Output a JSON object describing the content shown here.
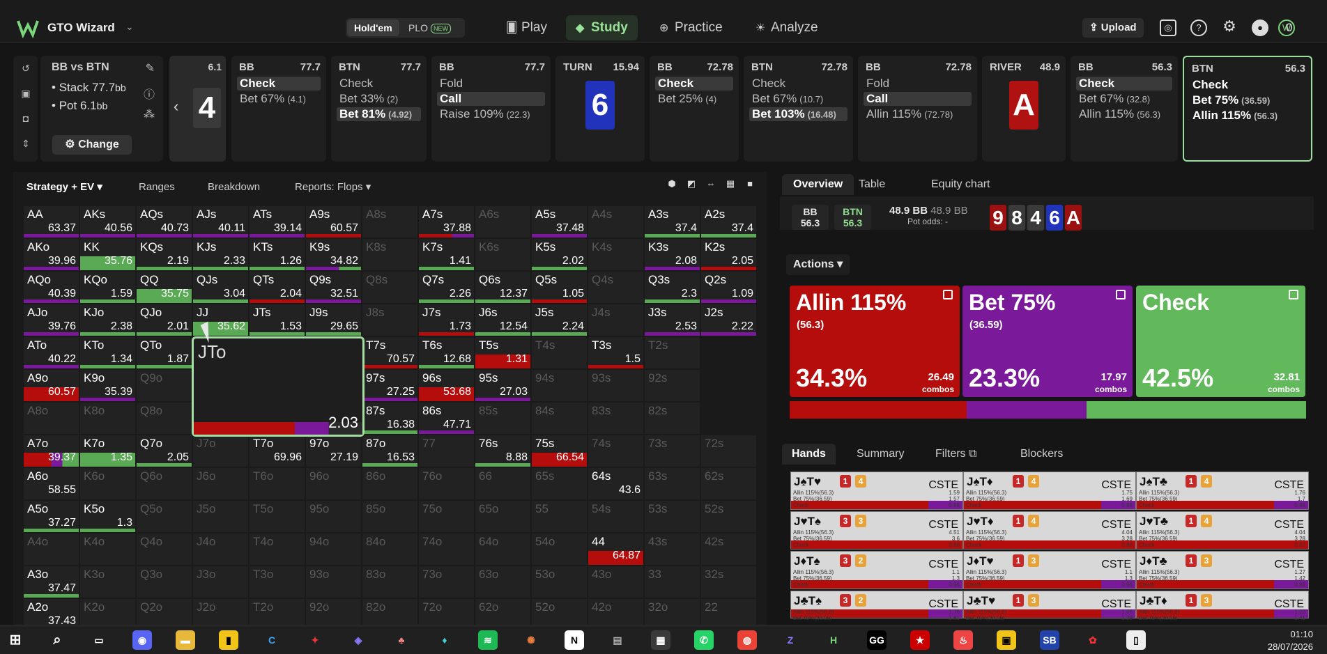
{
  "app": {
    "name": "GTO Wizard",
    "modes": [
      "Hold'em",
      "PLO"
    ],
    "new_badge": "NEW",
    "nav": [
      "Play",
      "Study",
      "Practice",
      "Analyze"
    ],
    "upload": "Upload",
    "credit": "0"
  },
  "spot": {
    "title": "BB vs BTN",
    "stack_label": "Stack",
    "stack": "77.7",
    "pot_label": "Pot",
    "pot": "6.1",
    "bb_unit": "bb",
    "change": "Change",
    "flop_pot": "6.1",
    "flop_card": "4"
  },
  "nodes": [
    {
      "hd": "BB",
      "pot": "77.7",
      "acts": [
        {
          "l": "Check",
          "s": "",
          "sel": true
        },
        {
          "l": "Bet 67%",
          "s": "(4.1)"
        }
      ]
    },
    {
      "hd": "BTN",
      "pot": "77.7",
      "acts": [
        {
          "l": "Check",
          "s": ""
        },
        {
          "l": "Bet 33%",
          "s": "(2)"
        },
        {
          "l": "Bet 81%",
          "s": "(4.92)",
          "sel": true
        }
      ]
    },
    {
      "hd": "BB",
      "pot": "77.7",
      "acts": [
        {
          "l": "Fold",
          "s": ""
        },
        {
          "l": "Call",
          "s": "",
          "sel": true
        },
        {
          "l": "Raise 109%",
          "s": "(22.3)"
        }
      ]
    },
    {
      "hd": "TURN",
      "pot": "15.94",
      "card": "6"
    },
    {
      "hd": "BB",
      "pot": "72.78",
      "acts": [
        {
          "l": "Check",
          "s": "",
          "sel": true
        },
        {
          "l": "Bet 25%",
          "s": "(4)"
        }
      ]
    },
    {
      "hd": "BTN",
      "pot": "72.78",
      "acts": [
        {
          "l": "Check",
          "s": ""
        },
        {
          "l": "Bet 67%",
          "s": "(10.7)"
        },
        {
          "l": "Bet 103%",
          "s": "(16.48)",
          "sel": true
        }
      ]
    },
    {
      "hd": "BB",
      "pot": "72.78",
      "acts": [
        {
          "l": "Fold",
          "s": ""
        },
        {
          "l": "Call",
          "s": "",
          "sel": true
        },
        {
          "l": "Allin 115%",
          "s": "(72.78)"
        }
      ]
    },
    {
      "hd": "RIVER",
      "pot": "48.9",
      "card": "A"
    },
    {
      "hd": "BB",
      "pot": "56.3",
      "acts": [
        {
          "l": "Check",
          "s": "",
          "sel": true
        },
        {
          "l": "Bet 67%",
          "s": "(32.8)"
        },
        {
          "l": "Allin 115%",
          "s": "(56.3)"
        }
      ]
    },
    {
      "hd": "BTN",
      "pot": "56.3",
      "acts": [
        {
          "l": "Check",
          "s": ""
        },
        {
          "l": "Bet 75%",
          "s": "(36.59)"
        },
        {
          "l": "Allin 115%",
          "s": "(56.3)"
        }
      ],
      "cur": true
    }
  ],
  "left_tabs": [
    "Strategy + EV",
    "Ranges",
    "Breakdown",
    "Reports: Flops"
  ],
  "grid": [
    [
      [
        "AA",
        "63.37",
        "p"
      ],
      [
        "AKs",
        "40.56",
        "p"
      ],
      [
        "AQs",
        "40.73",
        "p"
      ],
      [
        "AJs",
        "40.11",
        "p"
      ],
      [
        "ATs",
        "39.14",
        "p"
      ],
      [
        "A9s",
        "60.57",
        "r"
      ],
      [
        "A8s",
        "",
        ""
      ],
      [
        "A7s",
        "37.88",
        "rp"
      ],
      [
        "A6s",
        "",
        ""
      ],
      [
        "A5s",
        "37.48",
        "p"
      ],
      [
        "A4s",
        "",
        ""
      ],
      [
        "A3s",
        "37.4",
        "g"
      ],
      [
        "A2s",
        "37.4",
        "g"
      ]
    ],
    [
      [
        "AKo",
        "39.96",
        "p"
      ],
      [
        "KK",
        "35.76",
        "G"
      ],
      [
        "KQs",
        "2.19",
        "g"
      ],
      [
        "KJs",
        "2.33",
        "g"
      ],
      [
        "KTs",
        "1.26",
        "g"
      ],
      [
        "K9s",
        "34.82",
        "pg"
      ],
      [
        "K8s",
        "",
        ""
      ],
      [
        "K7s",
        "1.41",
        "g"
      ],
      [
        "K6s",
        "",
        ""
      ],
      [
        "K5s",
        "2.02",
        "g"
      ],
      [
        "K4s",
        "",
        ""
      ],
      [
        "K3s",
        "2.08",
        "p"
      ],
      [
        "K2s",
        "2.05",
        "r"
      ]
    ],
    [
      [
        "AQo",
        "40.39",
        "p"
      ],
      [
        "KQo",
        "1.59",
        "g"
      ],
      [
        "QQ",
        "35.75",
        "G"
      ],
      [
        "QJs",
        "3.04",
        "g"
      ],
      [
        "QTs",
        "2.04",
        "r"
      ],
      [
        "Q9s",
        "32.51",
        "p"
      ],
      [
        "Q8s",
        "",
        ""
      ],
      [
        "Q7s",
        "2.26",
        "g"
      ],
      [
        "Q6s",
        "12.37",
        "g"
      ],
      [
        "Q5s",
        "1.05",
        "r"
      ],
      [
        "Q4s",
        "",
        ""
      ],
      [
        "Q3s",
        "2.3",
        "g"
      ],
      [
        "Q2s",
        "1.09",
        "p"
      ]
    ],
    [
      [
        "AJo",
        "39.76",
        "p"
      ],
      [
        "KJo",
        "2.38",
        "g"
      ],
      [
        "QJo",
        "2.01",
        "g"
      ],
      [
        "JJ",
        "35.62",
        "G"
      ],
      [
        "JTs",
        "1.53",
        "g"
      ],
      [
        "J9s",
        "29.65",
        "g"
      ],
      [
        "J8s",
        "",
        ""
      ],
      [
        "J7s",
        "1.73",
        "r"
      ],
      [
        "J6s",
        "12.54",
        "g"
      ],
      [
        "J5s",
        "2.24",
        "g"
      ],
      [
        "J4s",
        "",
        ""
      ],
      [
        "J3s",
        "2.53",
        "p"
      ],
      [
        "J2s",
        "2.22",
        "p"
      ]
    ],
    [
      [
        "ATo",
        "40.22",
        "p"
      ],
      [
        "KTo",
        "1.34",
        "g"
      ],
      [
        "QTo",
        "1.87",
        "g"
      ],
      [
        "JTo",
        "2.03",
        ""
      ],
      [
        "T9s",
        "",
        ""
      ],
      [
        "T8s",
        "19.22",
        "p"
      ],
      [
        "T7s",
        "70.57",
        "r"
      ],
      [
        "T6s",
        "12.68",
        "g"
      ],
      [
        "T5s",
        "1.31",
        "R"
      ],
      [
        "T4s",
        "",
        ""
      ],
      [
        "T3s",
        "1.5",
        "r"
      ],
      [
        "T2s",
        "",
        ""
      ],
      [
        "",
        "",
        " "
      ]
    ],
    [
      [
        "A9o",
        "60.57",
        "R"
      ],
      [
        "K9o",
        "35.39",
        "p"
      ],
      [
        "Q9o",
        "",
        ""
      ],
      [
        "J9o",
        "",
        ""
      ],
      [
        "T9o",
        "",
        ""
      ],
      [
        "98s",
        "55.55",
        "R"
      ],
      [
        "97s",
        "27.25",
        "p"
      ],
      [
        "96s",
        "53.68",
        "R"
      ],
      [
        "95s",
        "27.03",
        "p"
      ],
      [
        "94s",
        "",
        ""
      ],
      [
        "93s",
        "",
        ""
      ],
      [
        "92s",
        "",
        ""
      ],
      [
        "",
        "",
        " "
      ]
    ],
    [
      [
        "A8o",
        "",
        ""
      ],
      [
        "K8o",
        "",
        ""
      ],
      [
        "Q8o",
        "",
        ""
      ],
      [
        "J8o",
        "",
        ""
      ],
      [
        "T8o",
        "",
        ""
      ],
      [
        "88",
        "64.24",
        "R"
      ],
      [
        "87s",
        "16.38",
        "g"
      ],
      [
        "86s",
        "47.71",
        "p"
      ],
      [
        "85s",
        "",
        ""
      ],
      [
        "84s",
        "",
        ""
      ],
      [
        "83s",
        "",
        ""
      ],
      [
        "82s",
        "",
        ""
      ],
      [
        "",
        "",
        " "
      ]
    ],
    [
      [
        "A7o",
        "39.37",
        "RP"
      ],
      [
        "K7o",
        "1.35",
        "G"
      ],
      [
        "Q7o",
        "2.05",
        "g"
      ],
      [
        "J7o",
        "",
        ""
      ],
      [
        "T7o",
        "69.96",
        ""
      ],
      [
        "97o",
        "27.19",
        ""
      ],
      [
        "87o",
        "16.53",
        "g"
      ],
      [
        "77",
        "",
        ""
      ],
      [
        "76s",
        "8.88",
        "g"
      ],
      [
        "75s",
        "66.54",
        "R"
      ],
      [
        "74s",
        "",
        ""
      ],
      [
        "73s",
        "",
        ""
      ],
      [
        "72s",
        "",
        ""
      ]
    ],
    [
      [
        "A6o",
        "58.55",
        ""
      ],
      [
        "K6o",
        "",
        ""
      ],
      [
        "Q6o",
        "",
        ""
      ],
      [
        "J6o",
        "",
        ""
      ],
      [
        "T6o",
        "",
        ""
      ],
      [
        "96o",
        "",
        ""
      ],
      [
        "86o",
        "",
        ""
      ],
      [
        "76o",
        "",
        ""
      ],
      [
        "66",
        "",
        ""
      ],
      [
        "65s",
        "",
        ""
      ],
      [
        "64s",
        "43.6",
        ""
      ],
      [
        "63s",
        "",
        ""
      ],
      [
        "62s",
        "",
        ""
      ]
    ],
    [
      [
        "A5o",
        "37.27",
        "g"
      ],
      [
        "K5o",
        "1.3",
        "g"
      ],
      [
        "Q5o",
        "",
        ""
      ],
      [
        "J5o",
        "",
        ""
      ],
      [
        "T5o",
        "",
        ""
      ],
      [
        "95o",
        "",
        ""
      ],
      [
        "85o",
        "",
        ""
      ],
      [
        "75o",
        "",
        ""
      ],
      [
        "65o",
        "",
        ""
      ],
      [
        "55",
        "",
        ""
      ],
      [
        "54s",
        "",
        ""
      ],
      [
        "53s",
        "",
        ""
      ],
      [
        "52s",
        "",
        ""
      ]
    ],
    [
      [
        "A4o",
        "",
        ""
      ],
      [
        "K4o",
        "",
        ""
      ],
      [
        "Q4o",
        "",
        ""
      ],
      [
        "J4o",
        "",
        ""
      ],
      [
        "T4o",
        "",
        ""
      ],
      [
        "94o",
        "",
        ""
      ],
      [
        "84o",
        "",
        ""
      ],
      [
        "74o",
        "",
        ""
      ],
      [
        "64o",
        "",
        ""
      ],
      [
        "54o",
        "",
        ""
      ],
      [
        "44",
        "64.87",
        "R"
      ],
      [
        "43s",
        "",
        ""
      ],
      [
        "42s",
        "",
        ""
      ]
    ],
    [
      [
        "A3o",
        "37.47",
        "g"
      ],
      [
        "K3o",
        "",
        ""
      ],
      [
        "Q3o",
        "",
        ""
      ],
      [
        "J3o",
        "",
        ""
      ],
      [
        "T3o",
        "",
        ""
      ],
      [
        "93o",
        "",
        ""
      ],
      [
        "83o",
        "",
        ""
      ],
      [
        "73o",
        "",
        ""
      ],
      [
        "63o",
        "",
        ""
      ],
      [
        "53o",
        "",
        ""
      ],
      [
        "43o",
        "",
        ""
      ],
      [
        "33",
        "",
        ""
      ],
      [
        "32s",
        "",
        ""
      ]
    ],
    [
      [
        "A2o",
        "37.43",
        "g"
      ],
      [
        "K2o",
        "",
        ""
      ],
      [
        "Q2o",
        "",
        ""
      ],
      [
        "J2o",
        "",
        ""
      ],
      [
        "T2o",
        "",
        ""
      ],
      [
        "92o",
        "",
        ""
      ],
      [
        "82o",
        "",
        ""
      ],
      [
        "72o",
        "",
        ""
      ],
      [
        "62o",
        "",
        ""
      ],
      [
        "52o",
        "",
        ""
      ],
      [
        "42o",
        "",
        ""
      ],
      [
        "32o",
        "",
        ""
      ],
      [
        "22",
        "",
        ""
      ]
    ]
  ],
  "tooltip": {
    "hand": "JTo",
    "value": "2.03"
  },
  "right_tabs": [
    "Overview",
    "Table",
    "Equity chart"
  ],
  "players": [
    {
      "n": "BB",
      "v": "56.3"
    },
    {
      "n": "BTN",
      "v": "56.3"
    }
  ],
  "pot_line": "48.9 BB",
  "pot_line2": "48.9 BB",
  "pot_odds": "Pot odds:  -",
  "board": [
    "9",
    "8",
    "4",
    "6",
    "A"
  ],
  "actions_label": "Actions",
  "actions": [
    {
      "name": "Allin 115%",
      "size": "(56.3)",
      "pct": "34.3%",
      "combos": "26.49",
      "color": "#b50c0c",
      "freq": 34.3
    },
    {
      "name": "Bet 75%",
      "size": "(36.59)",
      "pct": "23.3%",
      "combos": "17.97",
      "color": "#7a1a9a",
      "freq": 23.3
    },
    {
      "name": "Check",
      "size": "",
      "pct": "42.5%",
      "combos": "32.81",
      "color": "#62b95c",
      "freq": 42.5
    }
  ],
  "combos_label": "combos",
  "hand_tabs": [
    "Hands",
    "Summary",
    "Filters",
    "Blockers"
  ],
  "hands": [
    {
      "c": "J♠T♥",
      "b1": "1",
      "b2": "4",
      "cs": "CSTE",
      "v": [
        "1.59",
        "1.57",
        "0.98"
      ]
    },
    {
      "c": "J♠T♦",
      "b1": "1",
      "b2": "4",
      "cs": "CSTE",
      "v": [
        "1.75",
        "1.69",
        "0.98"
      ]
    },
    {
      "c": "J♠T♣",
      "b1": "1",
      "b2": "4",
      "cs": "CSTE",
      "v": [
        "1.76",
        "1.7",
        "0.98"
      ]
    },
    {
      "c": "J♥T♠",
      "b1": "3",
      "b2": "3",
      "cs": "CSTE",
      "v": [
        "4.51",
        "3.6",
        "0.88"
      ]
    },
    {
      "c": "J♥T♦",
      "b1": "1",
      "b2": "4",
      "cs": "CSTE",
      "v": [
        "4.04",
        "3.28",
        "0.86"
      ]
    },
    {
      "c": "J♥T♣",
      "b1": "1",
      "b2": "4",
      "cs": "CSTE",
      "v": [
        "4.04",
        "3.28",
        "0.87"
      ]
    },
    {
      "c": "J♦T♠",
      "b1": "3",
      "b2": "2",
      "cs": "CSTE",
      "v": [
        "1.1",
        "1.3",
        "0.96"
      ]
    },
    {
      "c": "J♦T♥",
      "b1": "1",
      "b2": "3",
      "cs": "CSTE",
      "v": [
        "1.1",
        "1.3",
        "0.96"
      ]
    },
    {
      "c": "J♦T♣",
      "b1": "1",
      "b2": "3",
      "cs": "CSTE",
      "v": [
        "1.27",
        "1.42",
        "0.93"
      ]
    },
    {
      "c": "J♣T♠",
      "b1": "3",
      "b2": "2",
      "cs": "CSTE",
      "v": [
        "1.76",
        "1.81",
        ""
      ]
    },
    {
      "c": "J♣T♥",
      "b1": "1",
      "b2": "3",
      "cs": "CSTE",
      "v": [
        "1.06",
        "1.29",
        ""
      ]
    },
    {
      "c": "J♣T♦",
      "b1": "1",
      "b2": "3",
      "cs": "CSTE",
      "v": [
        "1.22",
        "1.41",
        ""
      ]
    }
  ],
  "mini_labels": [
    "Allin 115%(56.3)",
    "Bet 75%(36.59)",
    "Check"
  ],
  "clock": {
    "time": "01:10",
    "date": "28/07/2026"
  }
}
